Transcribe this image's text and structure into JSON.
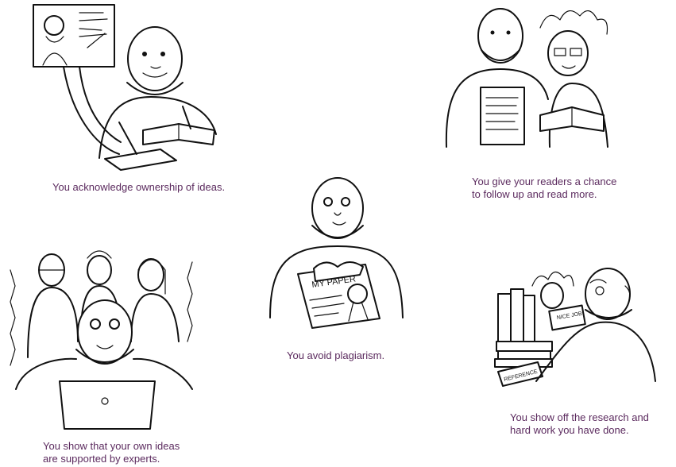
{
  "captions": {
    "ownership": "You acknowledge ownership of ideas.",
    "readers_line1": "You give your readers a chance",
    "readers_line2": "to follow up and read more.",
    "plagiarism": "You avoid plagiarism.",
    "experts_line1": "You show that your own ideas",
    "experts_line2": "are supported by experts.",
    "research_line1": "You show off the research and",
    "research_line2": "hard work you have done."
  },
  "drawn_text": {
    "paper_label": "MY PAPER",
    "note_label": "NICE JOB!",
    "book_spine": "REFERENCE"
  },
  "colors": {
    "caption": "#5b2a5e",
    "ink": "#111111",
    "background": "#ffffff"
  }
}
